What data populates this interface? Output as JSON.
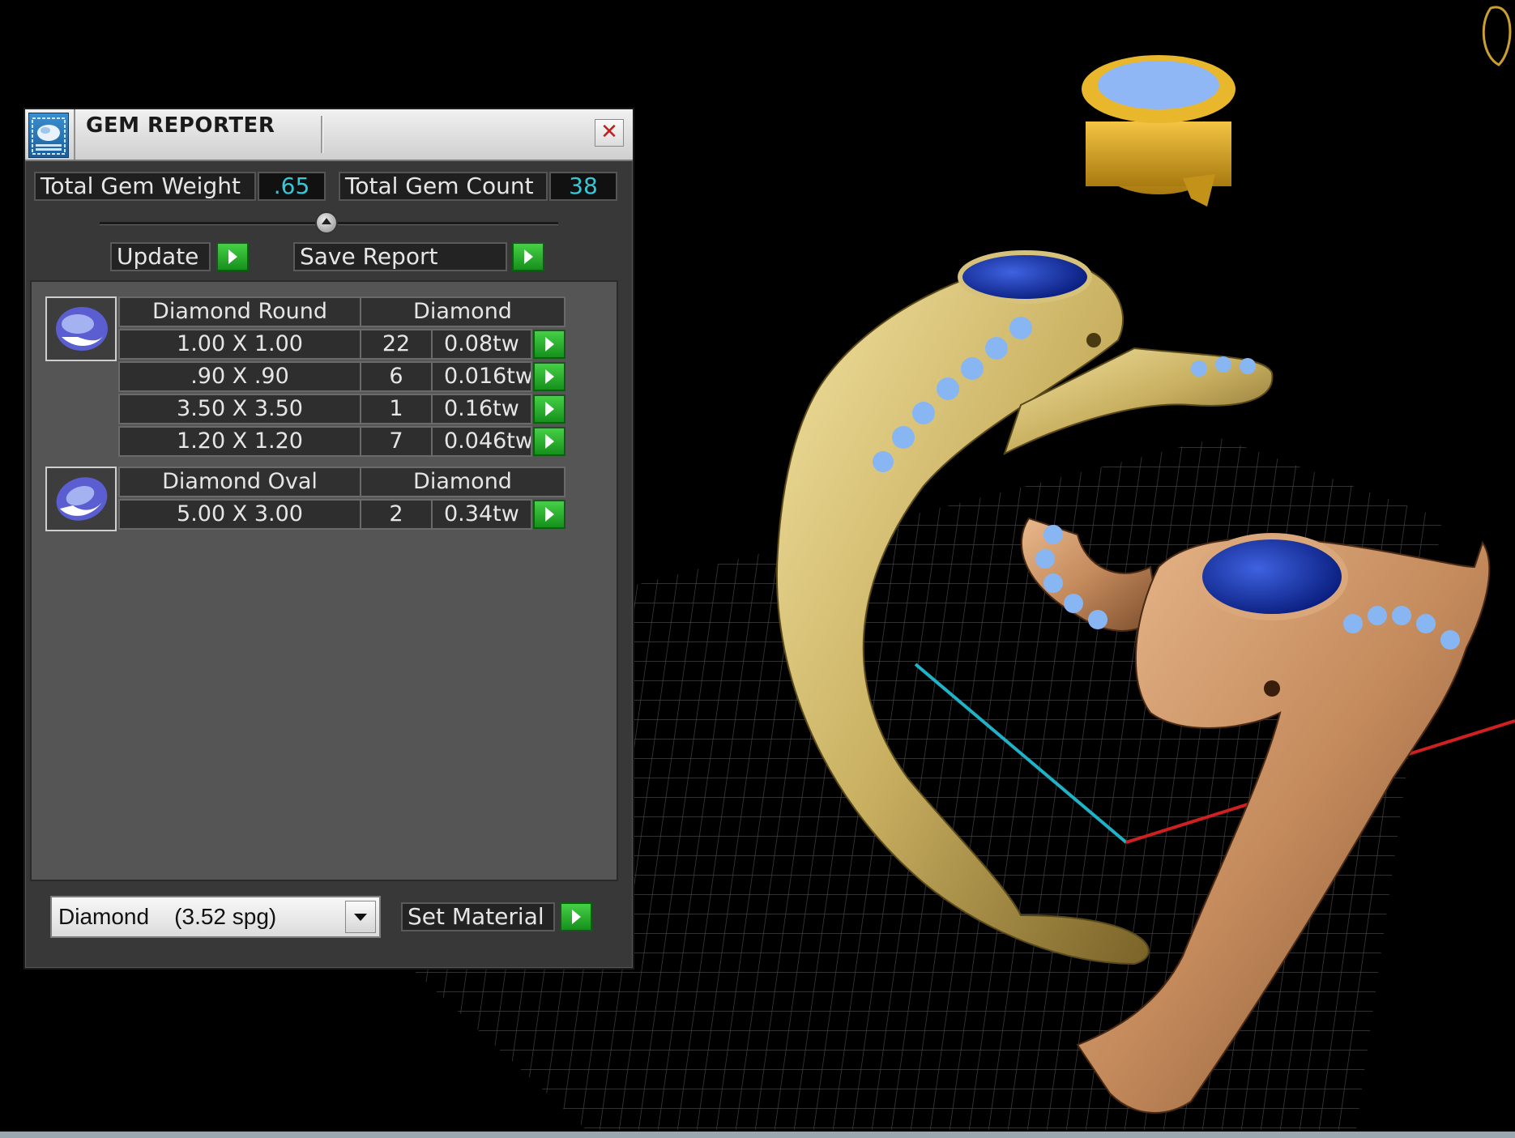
{
  "window": {
    "title": "GEM REPORTER"
  },
  "icons": {
    "app": "gem-reporter-icon",
    "close": "close-icon",
    "go": "play-arrow-icon",
    "dropdown": "chevron-down-icon",
    "gem_round": "round-gem-icon",
    "gem_oval": "oval-gem-icon"
  },
  "colors": {
    "value_text": "#37c8d8",
    "go_button": "#22a82a",
    "panel_bg": "#383838",
    "list_bg": "#555555"
  },
  "stats": {
    "weight_label": "Total Gem Weight",
    "weight_value": ".65",
    "count_label": "Total Gem Count",
    "count_value": "38"
  },
  "buttons": {
    "update": "Update",
    "save_report": "Save Report",
    "set_material": "Set Material"
  },
  "groups": [
    {
      "name": "Diamond Round",
      "material": "Diamond",
      "rows": [
        {
          "size": "1.00 X 1.00",
          "count": "22",
          "weight": "0.08tw"
        },
        {
          "size": ".90 X .90",
          "count": "6",
          "weight": "0.016tw"
        },
        {
          "size": "3.50 X 3.50",
          "count": "1",
          "weight": "0.16tw"
        },
        {
          "size": "1.20 X 1.20",
          "count": "7",
          "weight": "0.046tw"
        }
      ]
    },
    {
      "name": "Diamond Oval",
      "material": "Diamond",
      "rows": [
        {
          "size": "5.00 X 3.00",
          "count": "2",
          "weight": "0.34tw"
        }
      ]
    }
  ],
  "material_select": {
    "value": "Diamond    (3.52 spg)"
  }
}
